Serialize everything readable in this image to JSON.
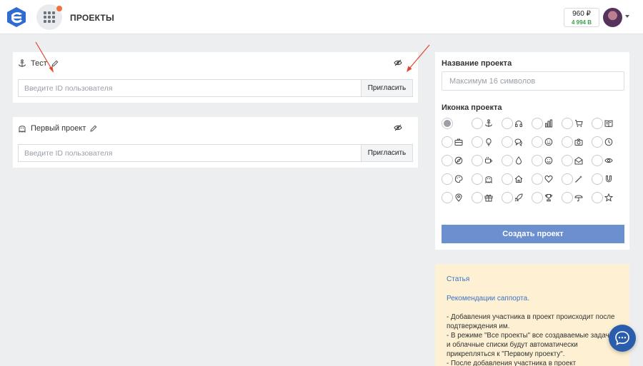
{
  "header": {
    "title": "ПРОЕКТЫ",
    "balance_primary": "960 ₽",
    "balance_secondary": "4 994 B"
  },
  "projects": [
    {
      "name": "Тест",
      "icon": "anchor-icon",
      "input_placeholder": "Введите ID пользователя",
      "invite_label": "Пригласить"
    },
    {
      "name": "Первый проект",
      "icon": "ghost-icon",
      "input_placeholder": "Введите ID пользователя",
      "invite_label": "Пригласить"
    }
  ],
  "create_panel": {
    "name_label": "Название проекта",
    "name_placeholder": "Максимум 16 символов",
    "icon_label": "Иконка проекта",
    "icon_options": [
      "none",
      "anchor",
      "headphones",
      "chart",
      "cart",
      "book",
      "briefcase",
      "bulb",
      "chat",
      "smile",
      "camera",
      "clock",
      "compass",
      "cup",
      "drop",
      "drop-alt",
      "envelope",
      "eye",
      "palette",
      "ghost",
      "home",
      "heart",
      "wand",
      "magnet",
      "pin",
      "gift",
      "rocket",
      "trophy",
      "umbrella",
      "star"
    ],
    "selected_icon": "none",
    "create_label": "Создать проект"
  },
  "note": {
    "link_article": "Статья",
    "link_support": "Рекомендации саппорта.",
    "paragraph": "- Добавления участника в проект происходит после подтверждения им.\n- В режиме \"Все проекты\" все создаваемые задачи и облачные списки будут автоматически прикрепляться к \"Первому проекту\".\n- После добавления участника в проект"
  },
  "colors": {
    "accent": "#6c8fcf",
    "link": "#3c73c6",
    "balance_green": "#3aa14a",
    "notification": "#f2713a",
    "note_bg": "#fdf0d3",
    "annotation_arrow": "#e0452c"
  }
}
